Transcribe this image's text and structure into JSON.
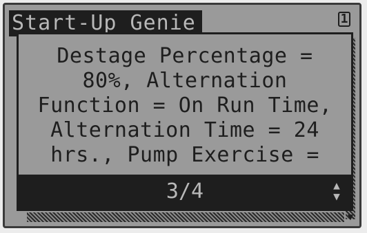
{
  "header": {
    "title": "Start-Up Genie",
    "page_number": "1"
  },
  "popup": {
    "lines": [
      "Destage Percentage =",
      "80%, Alternation",
      "Function = On Run Time,",
      "Alternation Time = 24",
      "hrs., Pump Exercise ="
    ],
    "page": "3/4"
  },
  "icons": {
    "scroll_up_down": "up-down-arrows-icon",
    "scroll_down": "scroll-down-arrow-icon"
  }
}
